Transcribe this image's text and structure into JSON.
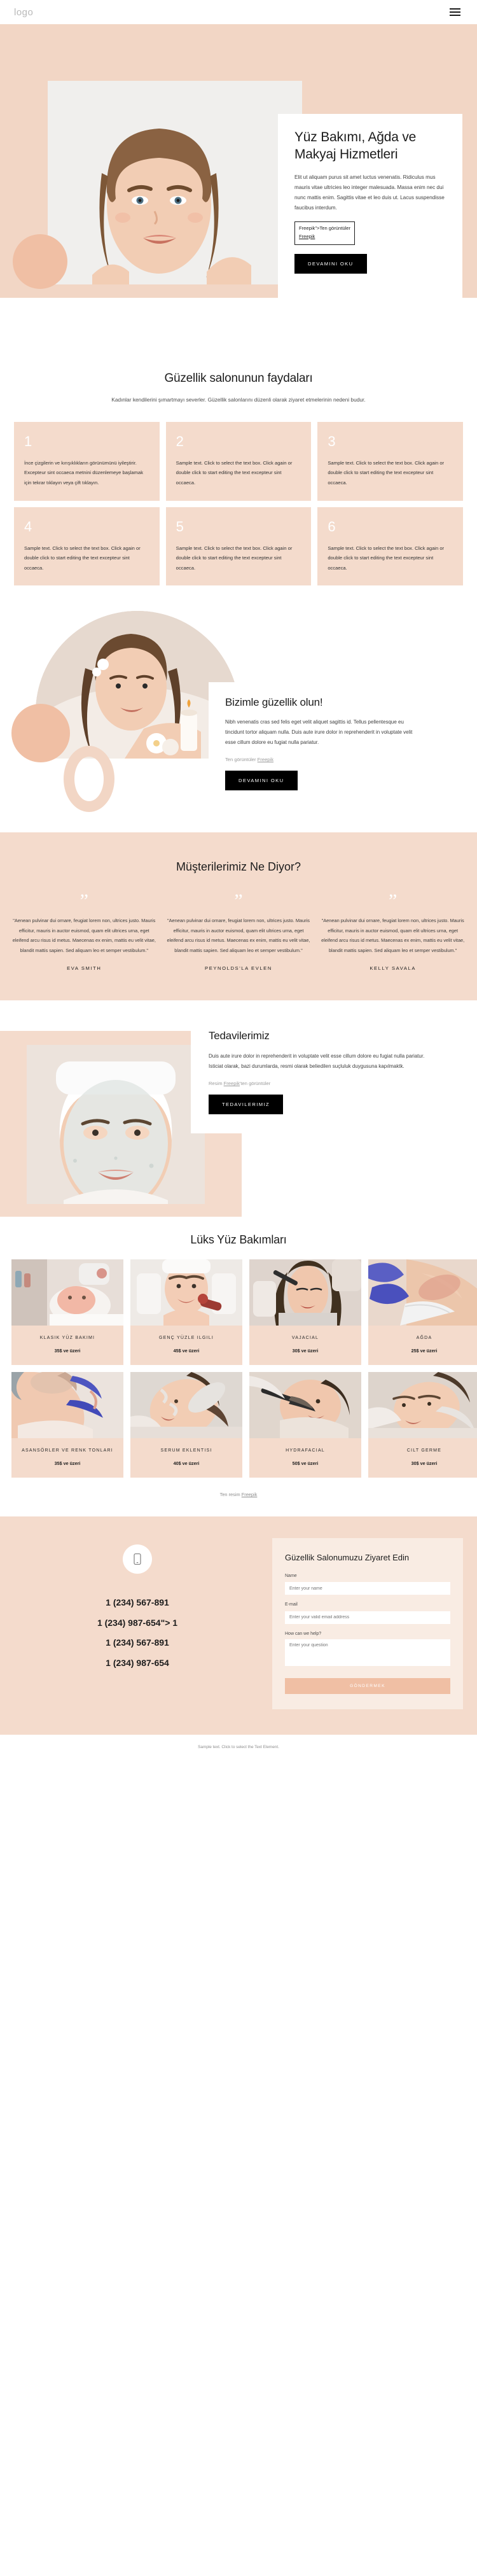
{
  "header": {
    "logo": "logo",
    "menu_icon": "hamburger-menu-icon"
  },
  "hero": {
    "title": "Yüz Bakımı, Ağda ve Makyaj Hizmetleri",
    "body": "Elit ut aliquam purus sit amet luctus venenatis. Ridiculus mus mauris vitae ultricies leo integer malesuada. Massa enim nec dui nunc mattis enim. Sagittis vitae et leo duis ut. Lacus suspendisse faucibus interdum.",
    "credit_line1": "Freepik\">Ten görüntüler",
    "credit_line2": "Freepik",
    "button": "DEVAMINI OKU"
  },
  "benefits": {
    "title": "Güzellik salonunun faydaları",
    "subtitle": "Kadınlar kendilerini şımartmayı severler. Güzellik salonlarını düzenli olarak ziyaret etmelerinin nedeni budur.",
    "sample_text": "Sample text. Click to select the text box. Click again or double click to start editing the text excepteur sint occaeca.",
    "cards": [
      {
        "num": "1",
        "text": "İnce çizgilerin ve kırışıklıkların görünümünü iyileştirir. Excepteur sint occaeca metnini düzenlemeye başlamak için tekrar tıklayın veya çift tıklayın."
      },
      {
        "num": "2",
        "text": "Sample text. Click to select the text box. Click again or double click to start editing the text excepteur sint occaeca."
      },
      {
        "num": "3",
        "text": "Sample text. Click to select the text box. Click again or double click to start editing the text excepteur sint occaeca."
      },
      {
        "num": "4",
        "text": "Sample text. Click to select the text box. Click again or double click to start editing the text excepteur sint occaeca."
      },
      {
        "num": "5",
        "text": "Sample text. Click to select the text box. Click again or double click to start editing the text excepteur sint occaeca."
      },
      {
        "num": "6",
        "text": "Sample text. Click to select the text box. Click again or double click to start editing the text excepteur sint occaeca."
      }
    ]
  },
  "beauty": {
    "title": "Bizimle güzellik olun!",
    "body": "Nibh venenatis cras sed felis eget velit aliquet sagittis id. Tellus pellentesque eu tincidunt tortor aliquam nulla. Duis aute irure dolor in reprehenderit in voluptate velit esse cillum dolore eu fugiat nulla pariatur.",
    "credit_prefix": "Ten görüntüler ",
    "credit_link": "Freepik",
    "button": "DEVAMINI OKU"
  },
  "testimonials": {
    "title": "Müşterilerimiz Ne Diyor?",
    "quote_glyph": "”",
    "items": [
      {
        "text": "\"Aenean pulvinar dui ornare, feugiat lorem non, ultrices justo. Mauris efficitur, mauris in auctor euismod, quam elit ultrices urna, eget eleifend arcu risus id metus. Maecenas ex enim, mattis eu velit vitae, blandit mattis sapien. Sed aliquam leo et semper vestibulum.\"",
        "name": "EVA SMITH"
      },
      {
        "text": "\"Aenean pulvinar dui ornare, feugiat lorem non, ultrices justo. Mauris efficitur, mauris in auctor euismod, quam elit ultrices urna, eget eleifend arcu risus id metus. Maecenas ex enim, mattis eu velit vitae, blandit mattis sapien. Sed aliquam leo et semper vestibulum.\"",
        "name": "PEYNOLDS'LA EVLEN"
      },
      {
        "text": "\"Aenean pulvinar dui ornare, feugiat lorem non, ultrices justo. Mauris efficitur, mauris in auctor euismod, quam elit ultrices urna, eget eleifend arcu risus id metus. Maecenas ex enim, mattis eu velit vitae, blandit mattis sapien. Sed aliquam leo et semper vestibulum.\"",
        "name": "KELLY SAVALA"
      }
    ]
  },
  "treatments": {
    "title": "Tedavilerimiz",
    "body": "Duis aute irure dolor in reprehenderit in voluptate velit esse cillum dolore eu fugiat nulla pariatur. Isticiat olarak, bazi durumlarda, resmi olarak beliedilen suçluluk duygusuna kapılmaktk.",
    "credit_prefix": "Resim ",
    "credit_link": "Freepik",
    "credit_suffix": "'ten görüntüler",
    "button": "TEDAVILERIMIZ"
  },
  "gallery": {
    "title": "Lüks Yüz Bakımları",
    "credit_prefix": "Ten resim ",
    "credit_link": "Freepik",
    "items": [
      {
        "name": "KLASIK YÜZ BAKIMI",
        "price": "35$ ve üzeri"
      },
      {
        "name": "GENÇ YÜZLE ILGILI",
        "price": "45$ ve üzeri"
      },
      {
        "name": "VAJACIAL",
        "price": "30$ ve üzeri"
      },
      {
        "name": "AĞDA",
        "price": "25$ ve üzeri"
      },
      {
        "name": "ASANSÖRLER VE RENK TONLARI",
        "price": "35$ ve üzeri"
      },
      {
        "name": "SERUM EKLENTISI",
        "price": "40$ ve üzeri"
      },
      {
        "name": "HYDRAFACIAL",
        "price": "50$ ve üzeri"
      },
      {
        "name": "CILT GERME",
        "price": "30$ ve üzeri"
      }
    ]
  },
  "contact": {
    "phone_icon": "phone-icon",
    "phones": [
      "1 (234) 567-891",
      "1 (234) 987-654\"> 1",
      "1 (234) 567-891",
      "1 (234) 987-654"
    ],
    "form": {
      "title": "Güzellik Salonumuzu Ziyaret Edin",
      "name_label": "Name",
      "name_placeholder": "Enter your name",
      "email_label": "E-mail",
      "email_placeholder": "Enter your valid email address",
      "message_label": "How can we help?",
      "message_placeholder": "Enter your question",
      "submit": "GÖNDERMEK"
    }
  },
  "footer": {
    "text": "Sample text. Click to select the Text Element."
  },
  "colors": {
    "peach": "#f2d6c5",
    "peach_card": "#f4dbcc",
    "peach_accent": "#f0bfa4",
    "peach_light": "#f9ece3",
    "dark": "#000000"
  }
}
